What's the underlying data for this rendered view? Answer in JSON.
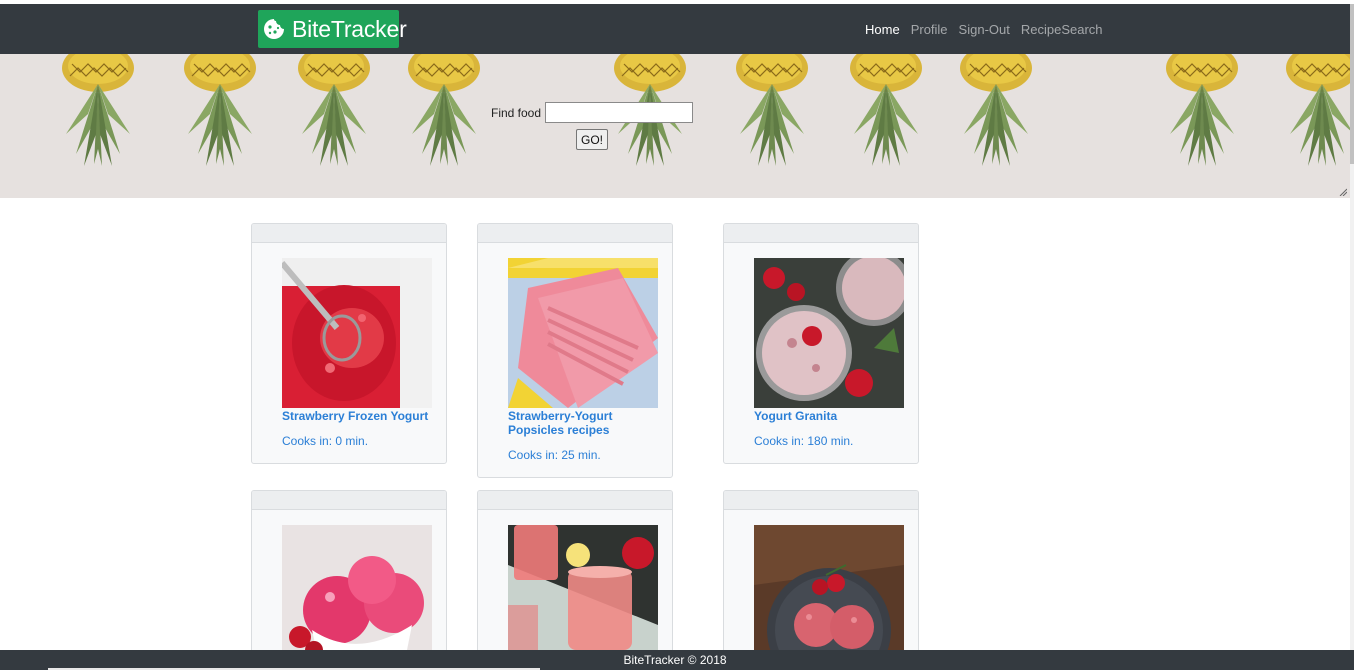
{
  "brand": {
    "name": "BiteTracker",
    "color": "#1fa55a"
  },
  "nav": [
    {
      "label": "Home",
      "active": true
    },
    {
      "label": "Profile",
      "active": false
    },
    {
      "label": "Sign-Out",
      "active": false
    },
    {
      "label": "RecipeSearch",
      "active": false
    }
  ],
  "search": {
    "label": "Find food",
    "value": "",
    "button": "GO!"
  },
  "recipes": [
    {
      "title": "Strawberry Frozen Yogurt",
      "cook": "Cooks in: 0 min."
    },
    {
      "title": "Strawberry-Yogurt Popsicles recipes",
      "cook": "Cooks in: 25 min."
    },
    {
      "title": "Yogurt Granita",
      "cook": "Cooks in: 180 min."
    },
    {
      "title": "",
      "cook": ""
    },
    {
      "title": "",
      "cook": ""
    },
    {
      "title": "",
      "cook": ""
    }
  ],
  "footer": {
    "text": "BiteTracker © 2018"
  },
  "colors": {
    "navbar": "#343a40",
    "link": "#2b7fd6",
    "hero": "#e6e1df"
  }
}
